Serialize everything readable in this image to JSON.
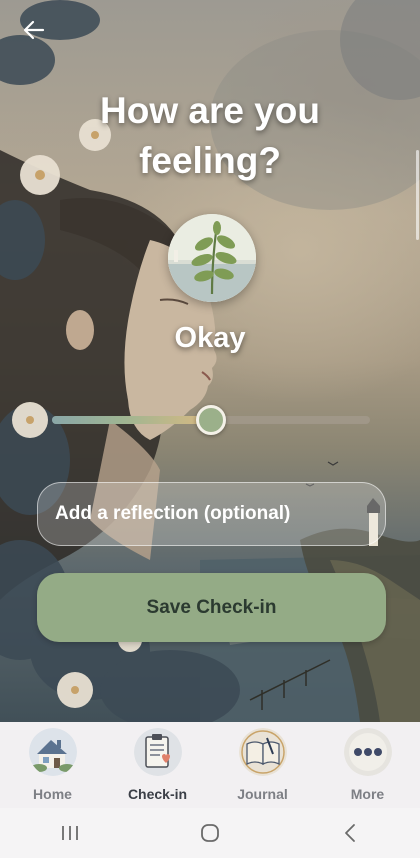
{
  "header": {
    "back_icon": "back-arrow-icon",
    "title": "How are you feeling?"
  },
  "mood": {
    "label": "Okay",
    "image": "leaf-sprig-illustration",
    "level": 0.5
  },
  "reflection": {
    "placeholder": "Add a reflection (optional)",
    "value": ""
  },
  "actions": {
    "save_label": "Save Check-in"
  },
  "nav": {
    "items": [
      {
        "label": "Home",
        "icon": "cottage-icon",
        "active": false
      },
      {
        "label": "Check-in",
        "icon": "clipboard-heart-icon",
        "active": true
      },
      {
        "label": "Journal",
        "icon": "open-book-icon",
        "active": false
      },
      {
        "label": "More",
        "icon": "more-dots-icon",
        "active": false
      }
    ]
  },
  "system_nav": {
    "recents_icon": "recents-icon",
    "home_icon": "home-circle-icon",
    "back_icon": "system-back-icon"
  },
  "colors": {
    "accent": "#94ab86",
    "thumb": "#9bb08a",
    "button_text": "#2b3a30"
  }
}
